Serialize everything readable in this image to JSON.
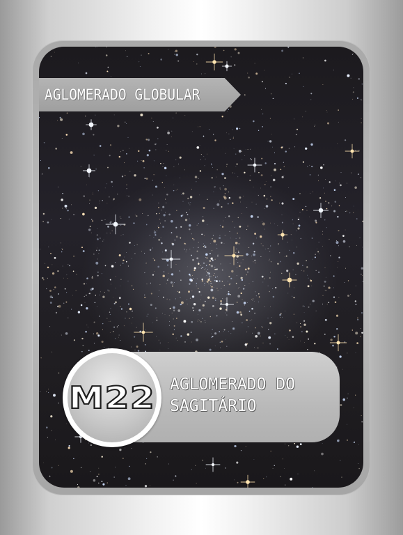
{
  "card": {
    "object_type": "AGLOMERADO GLOBULAR",
    "catalog_id": "M22",
    "name": "AGLOMERADO DO SAGITÁRIO",
    "image_subject": "globular-star-cluster"
  },
  "colors": {
    "frame": "#b5b5b5",
    "ribbon": "#a9a9a9",
    "badge_ring": "#ffffff",
    "label_text": "#ffffff",
    "sky": "#1f1d21"
  }
}
